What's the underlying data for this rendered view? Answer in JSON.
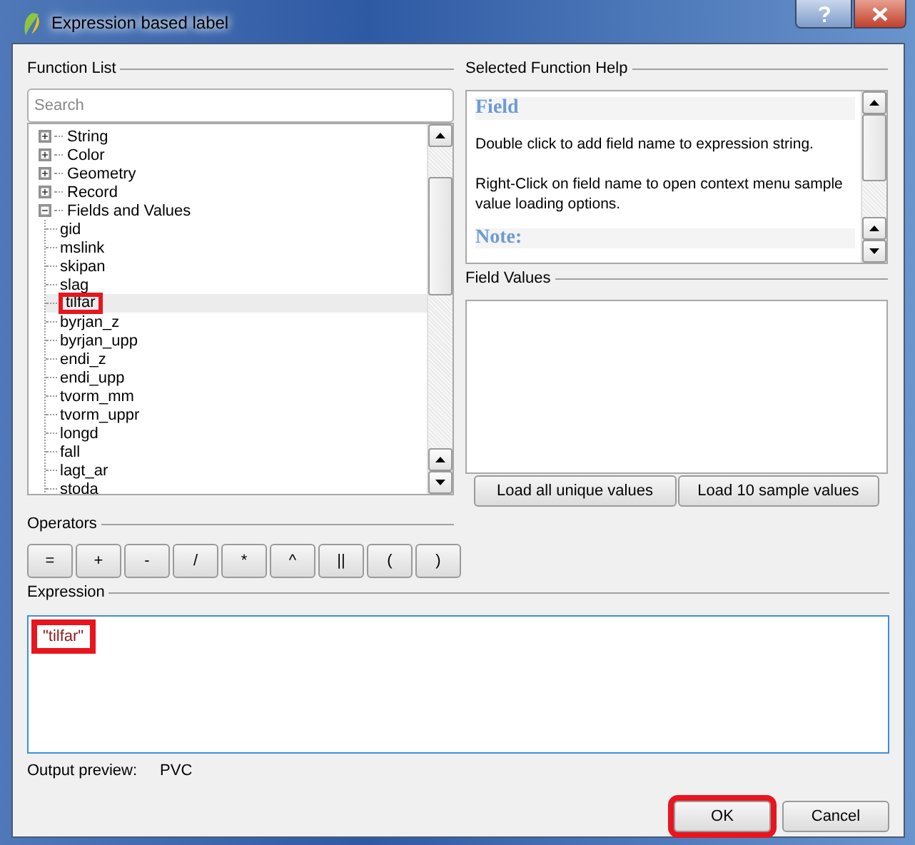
{
  "window": {
    "title": "Expression based label"
  },
  "function_list": {
    "label": "Function List",
    "search": {
      "placeholder": "Search"
    },
    "items": [
      {
        "label": "String",
        "expanded": false
      },
      {
        "label": "Color",
        "expanded": false
      },
      {
        "label": "Geometry",
        "expanded": false
      },
      {
        "label": "Record",
        "expanded": false
      },
      {
        "label": "Fields and Values",
        "expanded": true,
        "children": [
          {
            "label": "gid",
            "selected": false,
            "highlighted": false
          },
          {
            "label": "mslink",
            "selected": false,
            "highlighted": false
          },
          {
            "label": "skipan",
            "selected": false,
            "highlighted": false
          },
          {
            "label": "slag",
            "selected": false,
            "highlighted": false
          },
          {
            "label": "tilfar",
            "selected": true,
            "highlighted": true
          },
          {
            "label": "byrjan_z",
            "selected": false,
            "highlighted": false
          },
          {
            "label": "byrjan_upp",
            "selected": false,
            "highlighted": false
          },
          {
            "label": "endi_z",
            "selected": false,
            "highlighted": false
          },
          {
            "label": "endi_upp",
            "selected": false,
            "highlighted": false
          },
          {
            "label": "tvorm_mm",
            "selected": false,
            "highlighted": false
          },
          {
            "label": "tvorm_uppr",
            "selected": false,
            "highlighted": false
          },
          {
            "label": "longd",
            "selected": false,
            "highlighted": false
          },
          {
            "label": "fall",
            "selected": false,
            "highlighted": false
          },
          {
            "label": "lagt_ar",
            "selected": false,
            "highlighted": false
          },
          {
            "label": "stoda",
            "selected": false,
            "highlighted": false
          }
        ]
      }
    ]
  },
  "help": {
    "label": "Selected Function Help",
    "heading": "Field",
    "paragraphs": [
      "Double click to add field name to expression string.",
      "Right-Click on field name to open context menu sample value loading options."
    ],
    "note": "Note:"
  },
  "field_values": {
    "label": "Field Values",
    "buttons": [
      "Load all unique values",
      "Load 10 sample values"
    ]
  },
  "operators": {
    "label": "Operators",
    "buttons": [
      "=",
      "+",
      "-",
      "/",
      "*",
      "^",
      "||",
      "(",
      ")"
    ]
  },
  "expression": {
    "label": "Expression",
    "value": "\"tilfar\"",
    "highlighted": true
  },
  "output_preview": {
    "label": "Output preview:",
    "value": "PVC"
  },
  "buttons": [
    {
      "label": "OK",
      "highlighted": true
    },
    {
      "label": "Cancel",
      "highlighted": false
    }
  ]
}
